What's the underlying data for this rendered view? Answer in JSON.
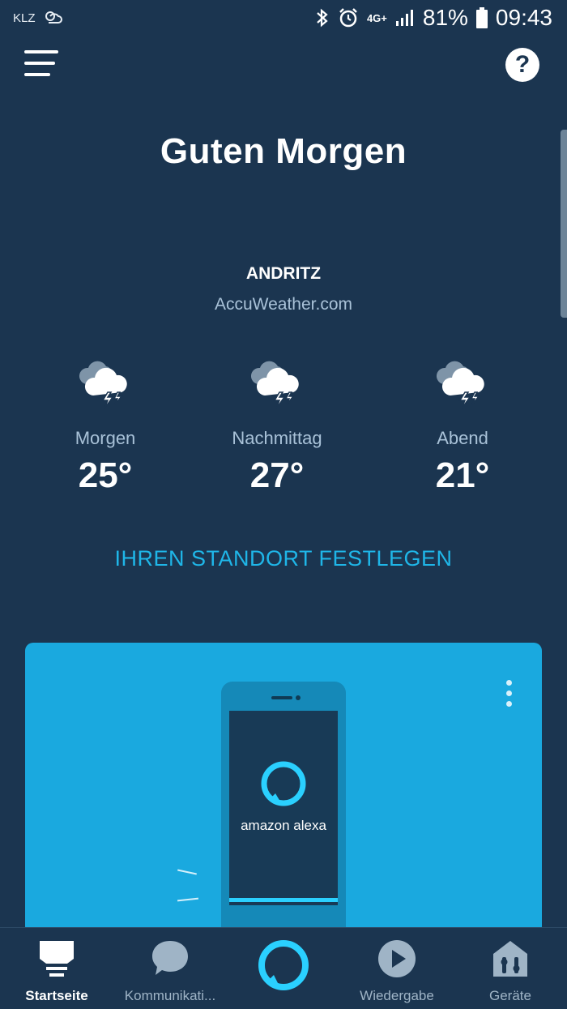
{
  "status_bar": {
    "carrier": "KLZ",
    "network": "4G+",
    "battery_percent": "81%",
    "time": "09:43"
  },
  "header": {
    "help_label": "?"
  },
  "greeting": "Guten Morgen",
  "weather": {
    "location": "ANDRITZ",
    "source": "AccuWeather.com",
    "forecasts": [
      {
        "label": "Morgen",
        "temp": "25°",
        "icon": "thunderstorm-icon"
      },
      {
        "label": "Nachmittag",
        "temp": "27°",
        "icon": "thunderstorm-icon"
      },
      {
        "label": "Abend",
        "temp": "21°",
        "icon": "thunderstorm-icon"
      }
    ],
    "set_location_label": "IHREN STANDORT FESTLEGEN"
  },
  "promo_card": {
    "phone_brand_text": "amazon alexa",
    "accent_color": "#1aa9df"
  },
  "bottom_nav": {
    "items": [
      {
        "label": "Startseite",
        "icon": "home-icon",
        "active": true
      },
      {
        "label": "Kommunikati...",
        "icon": "chat-bubble-icon",
        "active": false
      },
      {
        "label": "",
        "icon": "alexa-icon",
        "active": false
      },
      {
        "label": "Wiedergabe",
        "icon": "play-icon",
        "active": false
      },
      {
        "label": "Geräte",
        "icon": "devices-house-icon",
        "active": false
      }
    ]
  },
  "colors": {
    "background": "#1b3550",
    "link": "#1fb6e8",
    "muted_text": "#a9c2d8"
  }
}
